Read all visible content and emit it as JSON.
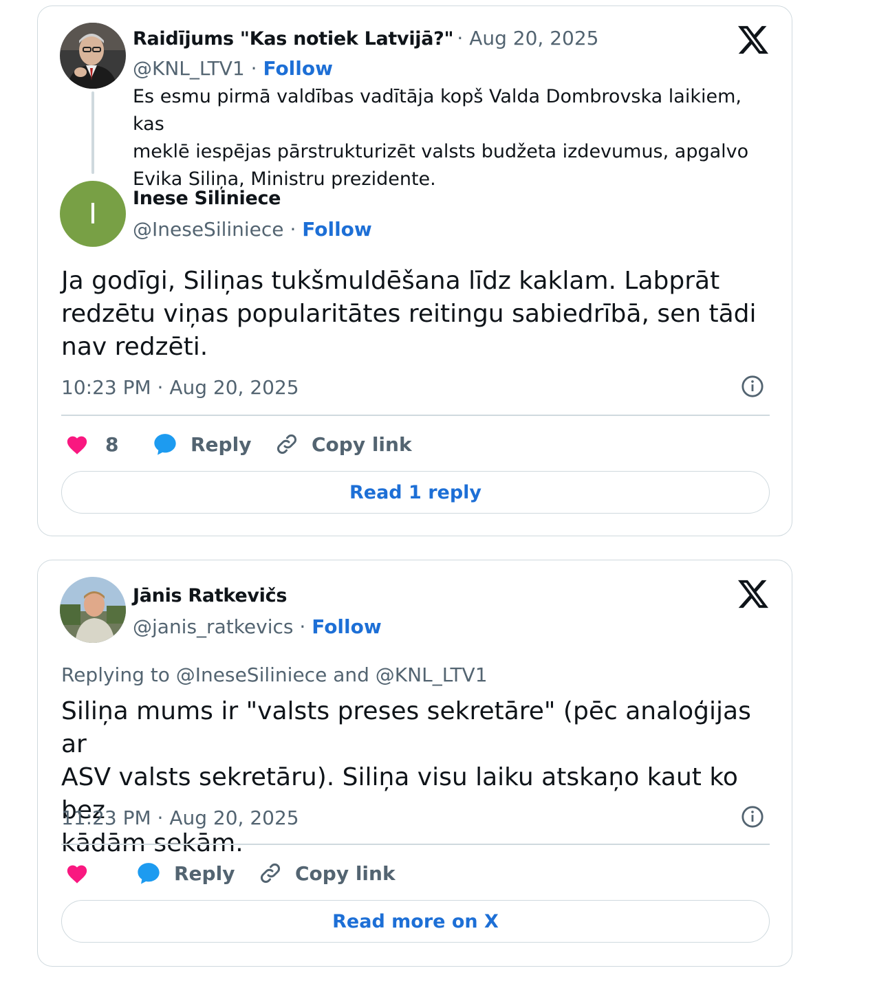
{
  "tweets": [
    {
      "quoted": {
        "author_name": "Raidījums \"Kas notiek Latvijā?\"",
        "date": "Aug 20, 2025",
        "handle": "@KNL_LTV1",
        "follow_label": "Follow",
        "text_lines": [
          "Es esmu pirmā valdības vadītāja kopš Valda Dombrovska laikiem, kas",
          "meklē iespējas pārstrukturizēt valsts budžeta izdevumus, apgalvo",
          "Evika Siliņa, Ministru prezidente."
        ]
      },
      "author_name": "Inese Siliniece",
      "handle": "@IneseSiliniece",
      "follow_label": "Follow",
      "avatar_initial": "I",
      "avatar_color": "#78a045",
      "text_lines": [
        "Ja godīgi, Siliņas tukšmuldēšana līdz kaklam. Labprāt",
        "redzētu viņas popularitātes reitingu sabiedrībā, sen tādi",
        "nav redzēti."
      ],
      "timestamp": "10:23 PM · Aug 20, 2025",
      "likes": "8",
      "reply_label": "Reply",
      "copy_link_label": "Copy link",
      "footer_button": "Read 1 reply"
    },
    {
      "author_name": "Jānis Ratkevičs",
      "handle": "@janis_ratkevics",
      "follow_label": "Follow",
      "replying_prefix": "Replying to",
      "replying_user1": "@IneseSiliniece",
      "replying_and": "and",
      "replying_user2": "@KNL_LTV1",
      "text_lines": [
        "Siliņa mums ir \"valsts preses sekretāre\" (pēc analoģijas ar",
        "ASV valsts sekretāru). Siliņa visu laiku atskaņo kaut ko bez",
        "kādām sekām."
      ],
      "timestamp": "11:23 PM · Aug 20, 2025",
      "reply_label": "Reply",
      "copy_link_label": "Copy link",
      "footer_button": "Read more on X"
    }
  ],
  "icons": {
    "platform": "x-logo-icon",
    "info": "info-icon",
    "like": "heart-icon",
    "reply": "speech-bubble-icon",
    "copy": "link-icon"
  },
  "colors": {
    "link_blue": "#1d6fd6",
    "heart_pink": "#f91880",
    "reply_blue": "#1d9bf0",
    "muted": "#536471",
    "border": "#cfd9de"
  }
}
